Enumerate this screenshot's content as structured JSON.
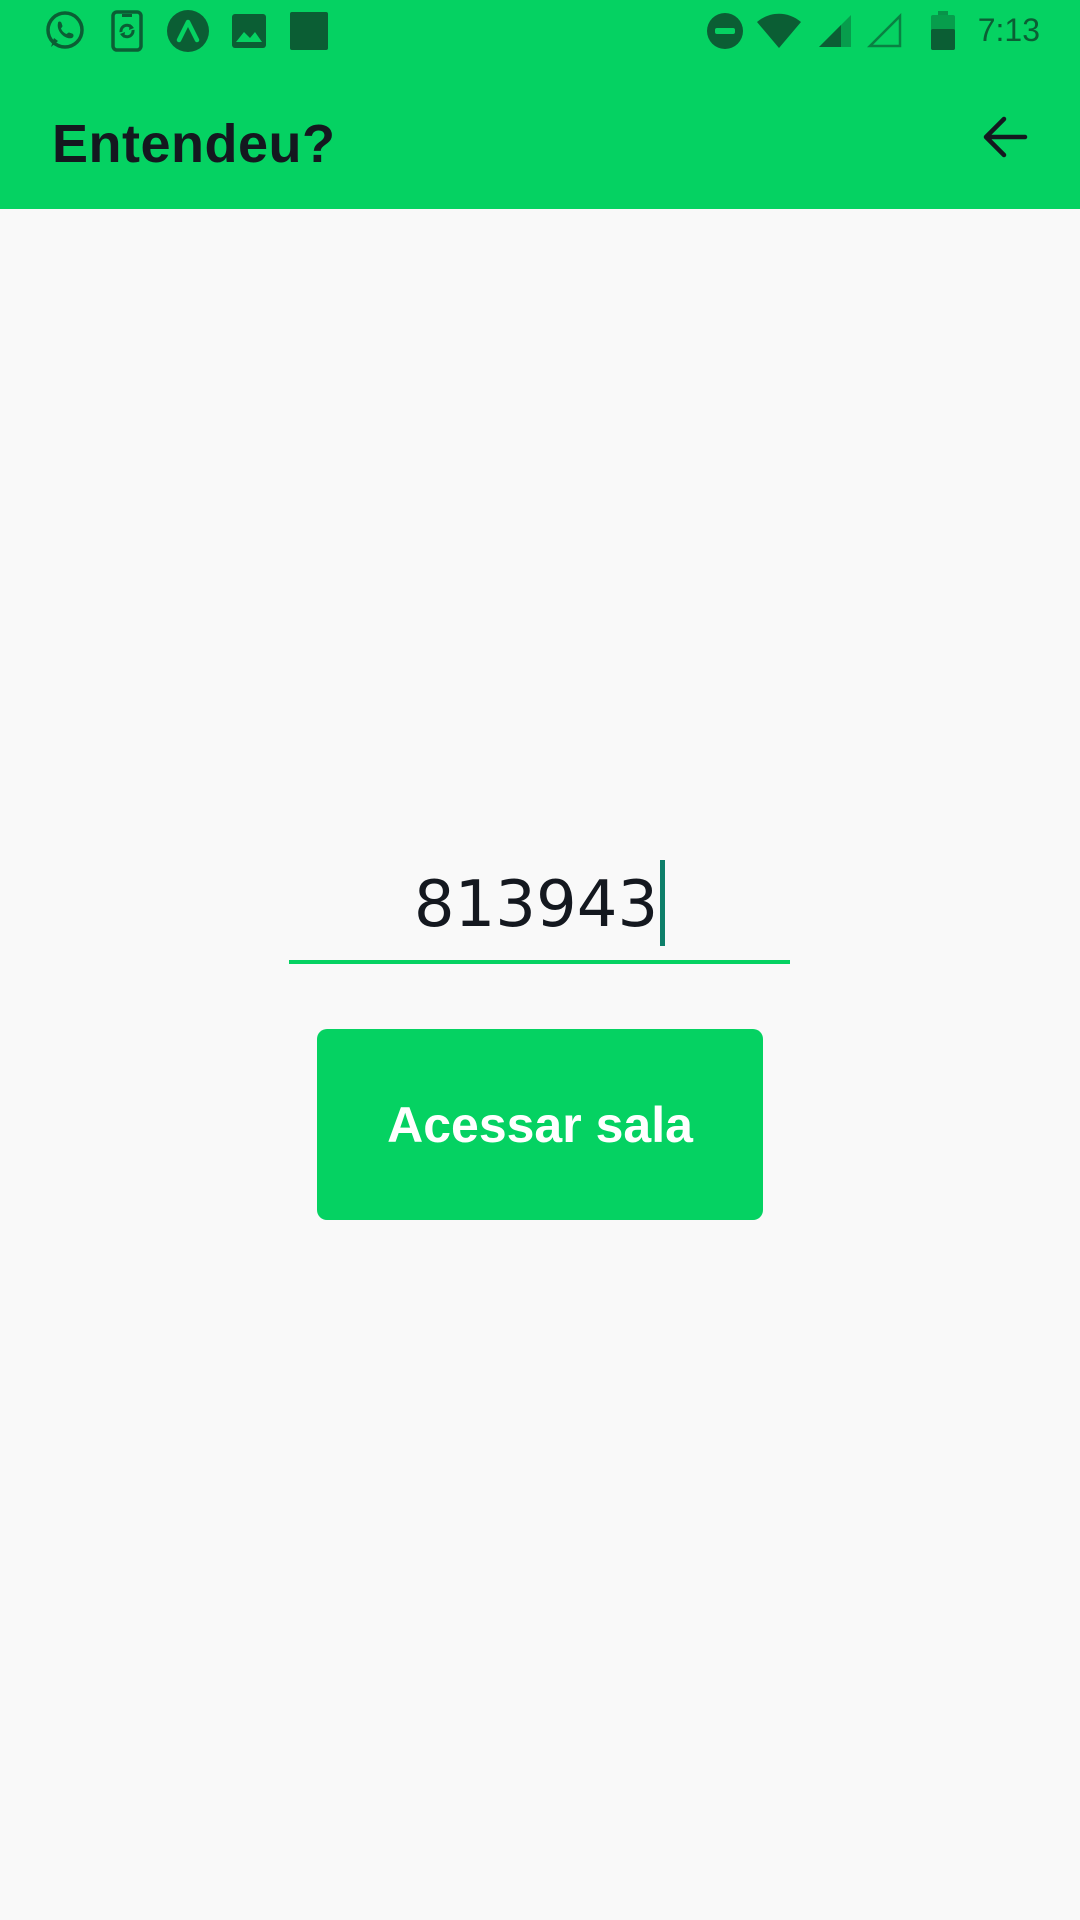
{
  "status_bar": {
    "icons_left": [
      "whatsapp-icon",
      "phone-sync-icon",
      "arrow-up-circle-icon",
      "image-icon",
      "square-icon"
    ],
    "icons_right": [
      "do-not-disturb-icon",
      "wifi-icon",
      "signal-icon",
      "signal-empty-icon",
      "battery-icon"
    ],
    "time": "7:13",
    "color": "#05d262"
  },
  "app_bar": {
    "title": "Entendeu?",
    "back_icon": "arrow-left-icon"
  },
  "main": {
    "code_input": {
      "value": "813943"
    },
    "enter_button": {
      "label": "Acessar sala"
    }
  },
  "colors": {
    "accent": "#05d262",
    "text": "#14181f",
    "background": "#f9f9f9",
    "caret": "#0d7f6a"
  }
}
